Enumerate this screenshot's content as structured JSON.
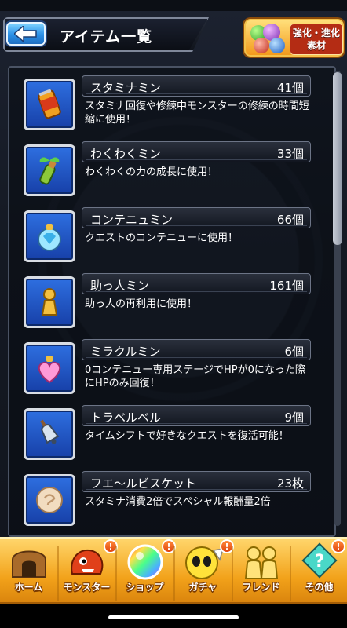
{
  "header": {
    "title": "アイテム一覧",
    "badge_lines": [
      "強化・進化",
      "素材"
    ]
  },
  "items": [
    {
      "name": "スタミナミン",
      "count": "41個",
      "desc": "スタミナ回復や修練中モンスターの修練の時間短縮に使用！",
      "icon": "stamina-can-icon"
    },
    {
      "name": "わくわくミン",
      "count": "33個",
      "desc": "わくわくの力の成長に使用！",
      "icon": "sprout-bottle-icon"
    },
    {
      "name": "コンテニュミン",
      "count": "66個",
      "desc": "クエストのコンテニューに使用！",
      "icon": "crystal-bottle-icon"
    },
    {
      "name": "助っ人ミン",
      "count": "161個",
      "desc": "助っ人の再利用に使用！",
      "icon": "pawn-icon"
    },
    {
      "name": "ミラクルミン",
      "count": "6個",
      "desc": "0コンテニュー専用ステージでHPが0になった際にHPのみ回復！",
      "icon": "heart-bottle-icon"
    },
    {
      "name": "トラベルベル",
      "count": "9個",
      "desc": "タイムシフトで好きなクエストを復活可能！",
      "icon": "bell-icon"
    },
    {
      "name": "フエ〜ルビスケット",
      "count": "23枚",
      "desc": "スタミナ消費2倍でスペシャル報酬量2倍",
      "icon": "biscuit-icon"
    }
  ],
  "nav": [
    {
      "label": "ホーム",
      "icon": "home-icon",
      "alert": ""
    },
    {
      "label": "モンスター",
      "icon": "monster-icon",
      "alert": "!"
    },
    {
      "label": "ショップ",
      "icon": "orb-icon",
      "alert": "!"
    },
    {
      "label": "ガチャ",
      "icon": "gacha-icon",
      "alert": "!"
    },
    {
      "label": "フレンド",
      "icon": "friends-icon",
      "alert": ""
    },
    {
      "label": "その他",
      "icon": "other-icon",
      "alert": "!"
    }
  ],
  "colors": {
    "accent": "#2a8fe6",
    "nav": "#f2a21a",
    "frame": "#4a5364"
  }
}
